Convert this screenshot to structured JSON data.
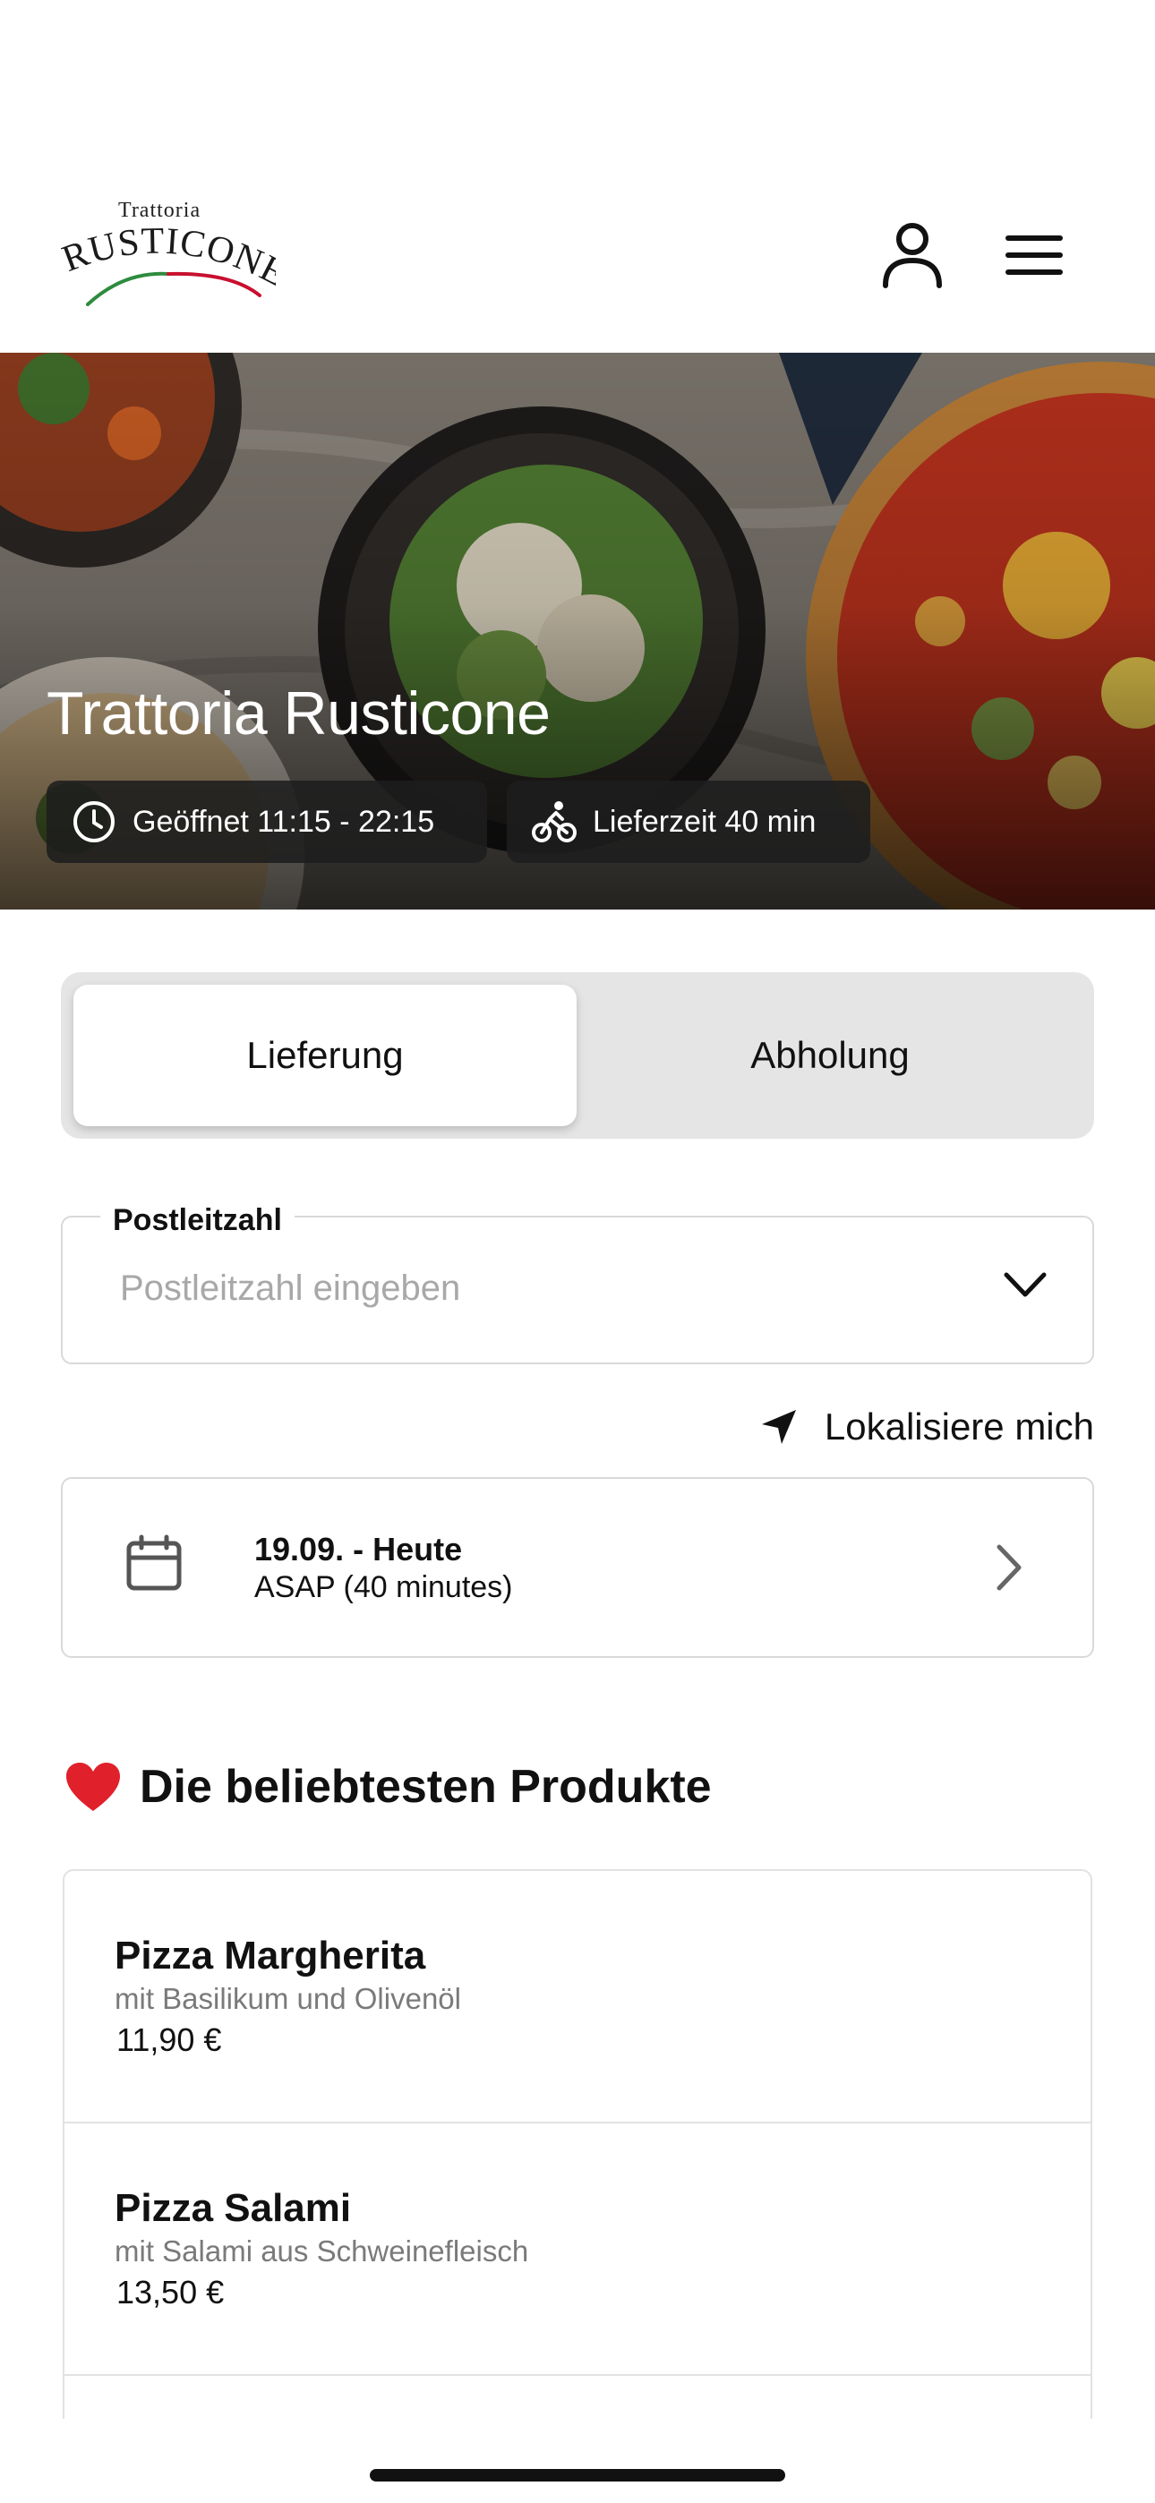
{
  "header": {
    "logo_small": "Trattoria",
    "logo_main": "RUSTICONE",
    "account_icon": "user-icon",
    "menu_icon": "hamburger-menu-icon"
  },
  "hero": {
    "title": "Trattoria Rusticone",
    "opening": "Geöffnet 11:15 - 22:15",
    "delivery_time": "Lieferzeit 40 min"
  },
  "order_mode": {
    "options": [
      "Lieferung",
      "Abholung"
    ],
    "selected": "Lieferung"
  },
  "postal": {
    "label": "Postleitzahl",
    "placeholder": "Postleitzahl eingeben",
    "value": ""
  },
  "locate": {
    "label": "Lokalisiere mich"
  },
  "schedule": {
    "date": "19.09. - Heute",
    "time": "ASAP (40 minutes)"
  },
  "popular": {
    "title": "Die beliebtesten Produkte",
    "products": [
      {
        "name": "Pizza Margherita",
        "desc": "mit Basilikum und Olivenöl",
        "price": "11,90 €"
      },
      {
        "name": "Pizza Salami",
        "desc": "mit Salami aus Schweinefleisch",
        "price": "13,50 €"
      }
    ]
  },
  "colors": {
    "accent_green": "#2e8b3e",
    "accent_red": "#c8102e",
    "segment_bg": "#e5e5e5"
  }
}
